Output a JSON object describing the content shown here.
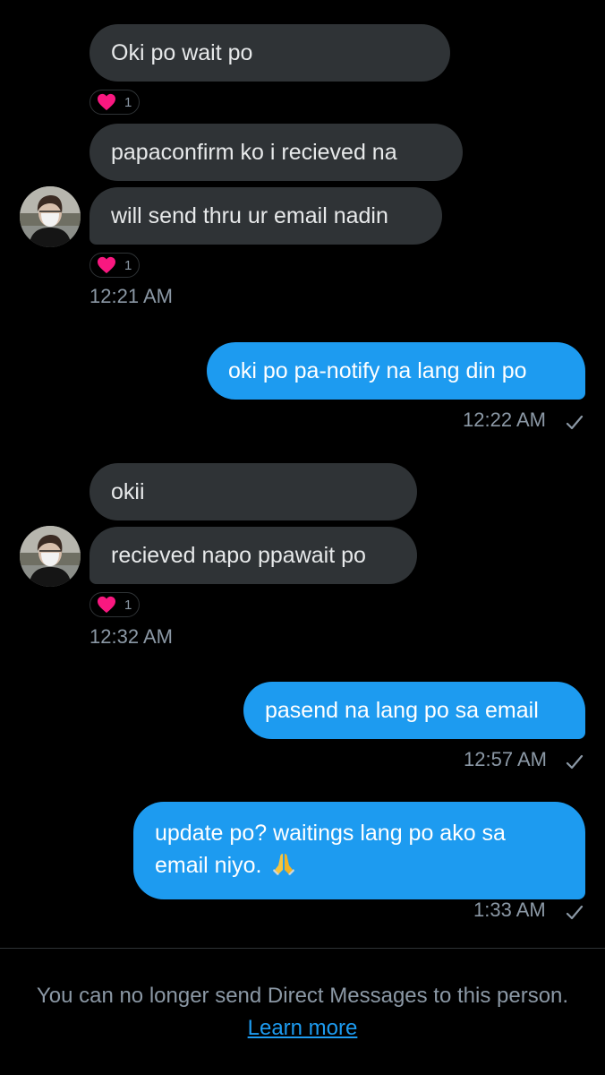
{
  "conversation": {
    "group1": {
      "msg1": "Oki po wait po",
      "msg1_reaction_count": "1",
      "msg2": "papaconfirm ko i recieved na",
      "msg3": "will send thru ur email nadin",
      "msg3_reaction_count": "1",
      "timestamp": "12:21 AM"
    },
    "sent1": {
      "text": "oki po pa-notify na lang din po",
      "timestamp": "12:22 AM"
    },
    "group2": {
      "msg1": "okii",
      "msg2": "recieved napo ppawait po",
      "msg2_reaction_count": "1",
      "timestamp": "12:32 AM"
    },
    "sent2": {
      "text": "pasend na lang po sa email",
      "timestamp": "12:57 AM"
    },
    "sent3": {
      "line1": "update po? waitings lang po ako sa",
      "line2": "email niyo.",
      "emoji": "folded-hands-emoji",
      "timestamp": "1:33 AM"
    }
  },
  "footer": {
    "notice_text": "You can no longer send Direct Messages to this person.",
    "learn_more": "Learn more"
  },
  "colors": {
    "background": "#000000",
    "incoming_bubble": "#2f3336",
    "outgoing_bubble": "#1d9bf0",
    "heart": "#f91880",
    "muted_text": "#8b98a5"
  },
  "icons": {
    "reaction": "heart-icon",
    "read_receipt": "checkmark-icon",
    "avatar": "avatar"
  }
}
